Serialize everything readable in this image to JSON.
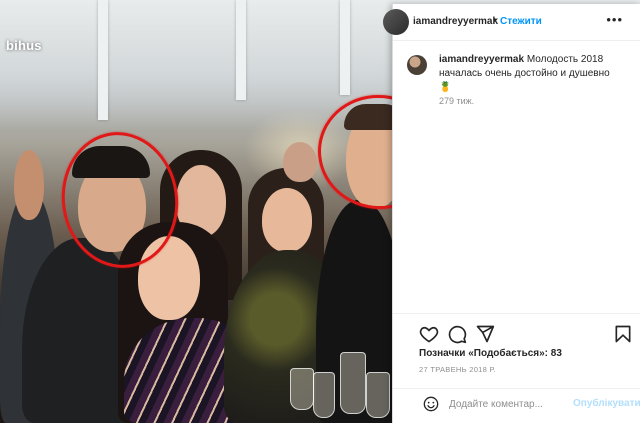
{
  "watermark": "bihus",
  "post": {
    "username": "iamandreyyermak",
    "follow_label": "Стежити",
    "header_separator": "•",
    "more_glyph": "•••",
    "caption_user": "iamandreyyermak",
    "caption_text": "Молодость 2018 началась очень достойно и душевно",
    "caption_emoji": "🍍",
    "caption_age": "279 тиж.",
    "likes_text": "Позначки «Подобається»: 83",
    "date": "27 ТРАВЕНЬ 2018 Р.",
    "comment_placeholder": "Додайте коментар...",
    "publish_label": "Опублікувати"
  },
  "icons": {
    "like": "heart-icon",
    "comment": "comment-icon",
    "share": "share-icon",
    "save": "bookmark-icon",
    "emoji": "smiley-icon",
    "more": "more-icon"
  },
  "colors": {
    "accent": "#0095f6",
    "annotation": "#e01818",
    "text": "#262626",
    "muted": "#8e8e8e"
  }
}
